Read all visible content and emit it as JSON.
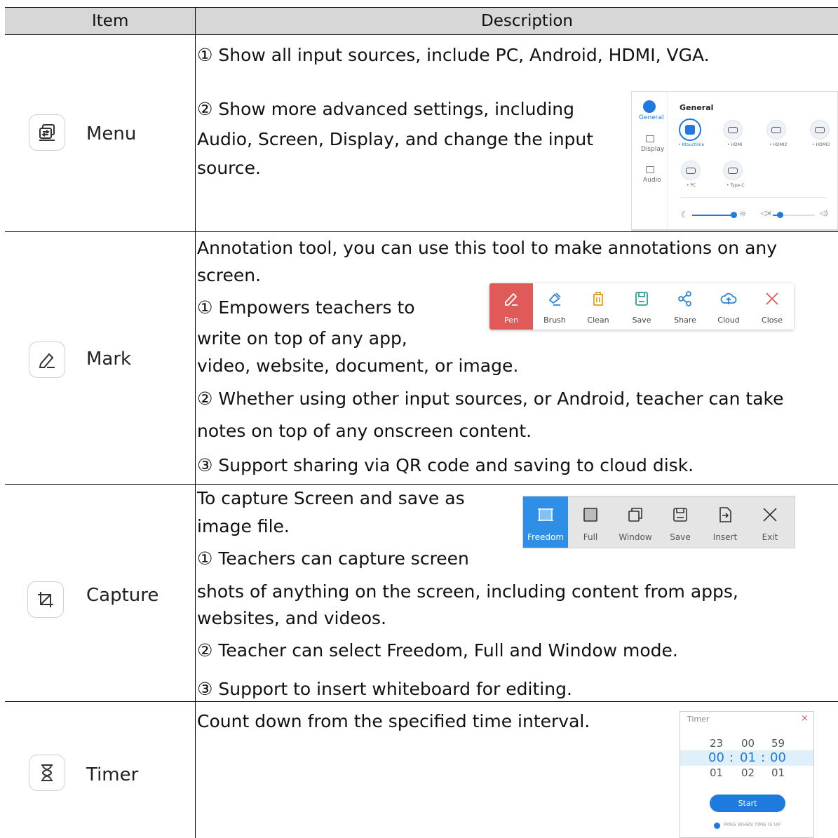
{
  "header": {
    "item": "Item",
    "description": "Description"
  },
  "rows": [
    {
      "label": "Menu",
      "icon": "switch-icon",
      "lines": [
        "① Show all input sources, include PC, Android, HDMI, VGA.",
        "② Show more advanced settings, including",
        "Audio, Screen, Display, and change the input",
        "source."
      ]
    },
    {
      "label": "Mark",
      "icon": "pen-icon",
      "lines": [
        "Annotation tool, you can use this tool to make annotations on any",
        "screen.",
        "① Empowers teachers to",
        "write on top of any app,",
        "video, website, document, or image.",
        "② Whether using other input sources, or Android, teacher can take",
        "notes on top of any onscreen content.",
        "③ Support sharing via QR code and saving to cloud disk."
      ]
    },
    {
      "label": "Capture",
      "icon": "crop-icon",
      "lines": [
        "To capture Screen and save as",
        "image file.",
        "① Teachers can capture screen",
        "shots of anything on the screen, including content from apps,",
        "websites, and videos.",
        "② Teacher can select Freedom, Full and Window mode.",
        "③ Support to insert whiteboard for editing."
      ]
    },
    {
      "label": "Timer",
      "icon": "hourglass-icon",
      "lines": [
        "Count down from the specified time interval."
      ]
    }
  ],
  "menu_shot": {
    "side": [
      "General",
      "Display",
      "Audio"
    ],
    "title": "General",
    "ports_row1": [
      "• Ktouchline",
      "• HDMI",
      "• HDMI2",
      "• HDMI3"
    ],
    "ports_row2": [
      "• PC",
      "• Type-C"
    ]
  },
  "mark_toolbar": [
    "Pen",
    "Brush",
    "Clean",
    "Save",
    "Share",
    "Cloud",
    "Close"
  ],
  "capture_toolbar": [
    "Freedom",
    "Full",
    "Window",
    "Save",
    "Insert",
    "Exit"
  ],
  "timer_shot": {
    "title": "Timer",
    "close": "×",
    "top": [
      "23",
      "00",
      "59"
    ],
    "mid": [
      "00",
      ":",
      "01",
      ":",
      "00"
    ],
    "bot": [
      "01",
      "02",
      "01"
    ],
    "start": "Start",
    "ring": "RING WHEN TIME IS UP"
  },
  "colors": {
    "accent": "#1f7ae0",
    "pen_red": "#e05a5a",
    "teal": "#2e9f96",
    "header_bg": "#d7d7d7"
  }
}
